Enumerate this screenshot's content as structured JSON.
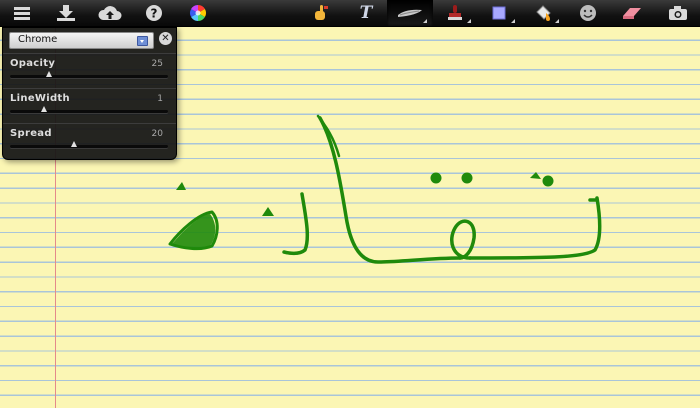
{
  "toolbar": {
    "tools": [
      {
        "name": "menu-icon"
      },
      {
        "name": "download-icon"
      },
      {
        "name": "cloud-upload-icon"
      },
      {
        "name": "help-icon"
      },
      {
        "name": "color-wheel-icon"
      },
      {
        "name": "pointer-hand-icon"
      },
      {
        "name": "text-tool-icon",
        "glyph": "T"
      },
      {
        "name": "brush-tool-icon",
        "active": true
      },
      {
        "name": "stamp-tool-icon"
      },
      {
        "name": "shape-tool-icon"
      },
      {
        "name": "fill-bucket-icon"
      },
      {
        "name": "emoji-icon"
      },
      {
        "name": "eraser-icon"
      },
      {
        "name": "camera-icon"
      }
    ]
  },
  "brush_panel": {
    "preset": "Chrome",
    "close_glyph": "✕",
    "settings": [
      {
        "label": "Opacity",
        "value": "25",
        "level": 0.25
      },
      {
        "label": "LineWidth",
        "value": "1",
        "level": 0.22
      },
      {
        "label": "Spread",
        "value": "20",
        "level": 0.41
      }
    ]
  },
  "colors": {
    "paper": "#fbf6b4",
    "rule_line": "#a9c5d9",
    "margin_line": "#e48a8a",
    "ink": "#1f8a0b"
  }
}
